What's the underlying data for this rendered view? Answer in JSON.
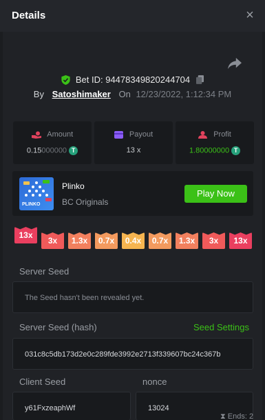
{
  "header": {
    "title": "Details",
    "close_symbol": "×"
  },
  "bet": {
    "id_text": "Bet ID: 94478349820244704",
    "by_label": "By",
    "username": "Satoshimaker",
    "on_label": "On",
    "datetime": "12/23/2022, 1:12:34 PM"
  },
  "stats": {
    "amount": {
      "label": "Amount",
      "value_bright": "0.15",
      "value_dim": "000000"
    },
    "payout": {
      "label": "Payout",
      "value": "13 x"
    },
    "profit": {
      "label": "Profit",
      "value_bright": "1.8",
      "value_dim": "0000000"
    },
    "coin_symbol": "T"
  },
  "game": {
    "name": "Plinko",
    "provider": "BC Originals",
    "play_label": "Play Now",
    "thumb_text": "PLINKO"
  },
  "multipliers": [
    {
      "label": "13x",
      "color": "#ea3f5f"
    },
    {
      "label": "3x",
      "color": "#f05a5a"
    },
    {
      "label": "1.3x",
      "color": "#f2805e"
    },
    {
      "label": "0.7x",
      "color": "#f39a5e"
    },
    {
      "label": "0.4x",
      "color": "#f6b550"
    },
    {
      "label": "0.7x",
      "color": "#f39a5e"
    },
    {
      "label": "1.3x",
      "color": "#f2805e"
    },
    {
      "label": "3x",
      "color": "#f05a5a"
    },
    {
      "label": "13x",
      "color": "#ea3f5f"
    }
  ],
  "highlighted_multiplier_index": 0,
  "seeds": {
    "server_seed_label": "Server Seed",
    "server_seed_value": "The Seed hasn't been revealed yet.",
    "server_hash_label": "Server Seed (hash)",
    "seed_settings_label": "Seed Settings",
    "server_hash_value": "031c8c5db173d2e0c289fde3992e2713f339607bc24c367b",
    "client_seed_label": "Client Seed",
    "client_seed_value": "y61FxzeaphWf",
    "nonce_label": "nonce",
    "nonce_value": "13024"
  },
  "footer": {
    "ends_text": "Ends: 2"
  },
  "colors": {
    "accent_green": "#3bc117",
    "panel": "#202226",
    "card": "#181a1d"
  }
}
